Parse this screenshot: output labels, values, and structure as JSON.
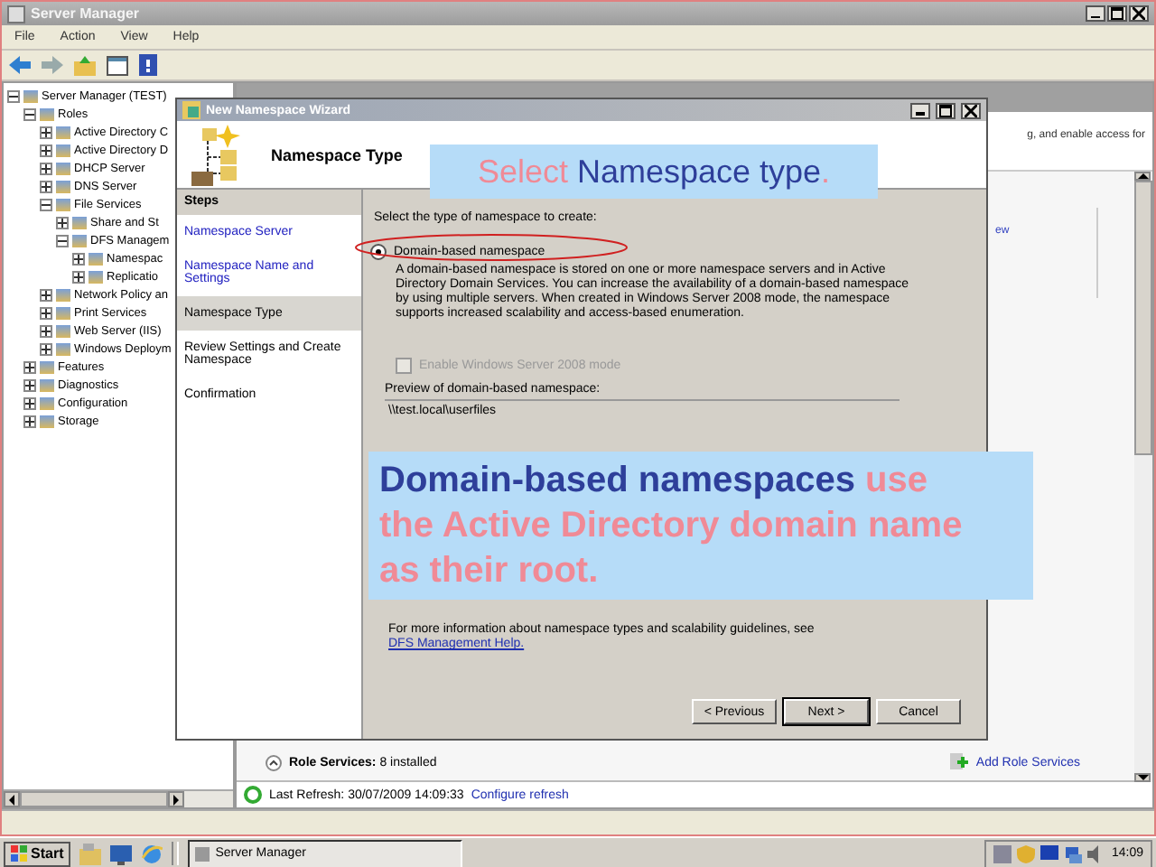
{
  "window": {
    "title": "Server Manager"
  },
  "menu": [
    "File",
    "Action",
    "View",
    "Help"
  ],
  "tree": [
    {
      "label": "Server Manager (TEST)",
      "expanded": true,
      "children": [
        {
          "label": "Roles",
          "expanded": true,
          "children": [
            {
              "label": "Active Directory C",
              "expanded": false
            },
            {
              "label": "Active Directory D",
              "expanded": false
            },
            {
              "label": "DHCP Server",
              "expanded": false
            },
            {
              "label": "DNS Server",
              "expanded": false
            },
            {
              "label": "File Services",
              "expanded": true,
              "children": [
                {
                  "label": "Share and St",
                  "expanded": false
                },
                {
                  "label": "DFS Managem",
                  "expanded": true,
                  "children": [
                    {
                      "label": "Namespac",
                      "expanded": false
                    },
                    {
                      "label": "Replicatio",
                      "expanded": false
                    }
                  ]
                }
              ]
            },
            {
              "label": "Network Policy an",
              "expanded": false
            },
            {
              "label": "Print Services",
              "expanded": false
            },
            {
              "label": "Web Server (IIS)",
              "expanded": false
            },
            {
              "label": "Windows Deploym",
              "expanded": false
            }
          ]
        },
        {
          "label": "Features",
          "expanded": false
        },
        {
          "label": "Diagnostics",
          "expanded": false
        },
        {
          "label": "Configuration",
          "expanded": false
        },
        {
          "label": "Storage",
          "expanded": false
        }
      ]
    }
  ],
  "right_pane": {
    "description": "g, and enable access for",
    "link_fragment": "ew",
    "role_services": {
      "label": "Role Services:",
      "value": "8 installed"
    },
    "add_link": "Add Role Services"
  },
  "refresh": {
    "text": "Last Refresh: 30/07/2009 14:09:33",
    "link": "Configure refresh"
  },
  "taskbar": {
    "start": "Start",
    "tasks": [
      {
        "label": "Server Manager",
        "selected": true
      }
    ],
    "clock": "14:09"
  },
  "wizard": {
    "title": "New Namespace Wizard",
    "heading": "Namespace Type",
    "steps_title": "Steps",
    "steps": [
      {
        "label": "Namespace Server",
        "selected": false,
        "done": true
      },
      {
        "label": "Namespace Name and Settings",
        "selected": false,
        "done": true
      },
      {
        "label": "Namespace Type",
        "selected": true,
        "done": false
      },
      {
        "label": "Review Settings and Create Namespace",
        "selected": false,
        "done": false
      },
      {
        "label": "Confirmation",
        "selected": false,
        "done": false
      }
    ],
    "prompt": "Select the type of namespace to create:",
    "option": {
      "label": "Domain-based namespace",
      "selected": true
    },
    "option_description": "A domain-based namespace is stored on one or more namespace servers and in Active Directory Domain Services. You can increase the availability of a domain-based namespace by using multiple servers. When created in Windows Server 2008 mode, the namespace supports increased scalability and access-based enumeration.",
    "mode_checkbox": {
      "label": "Enable Windows Server 2008 mode",
      "checked": false,
      "disabled": true
    },
    "preview_label": "Preview of domain-based namespace:",
    "preview_value": "\\\\test.local\\userfiles",
    "help_text": "For more information about namespace types and scalability guidelines, see",
    "help_link": "DFS Management Help.",
    "buttons": [
      {
        "label": "< Previous",
        "default": false
      },
      {
        "label": "Next >",
        "default": true
      },
      {
        "label": "Cancel",
        "default": false
      }
    ]
  },
  "callouts": [
    {
      "parts": [
        {
          "text": "Select ",
          "color": "#f08a96"
        },
        {
          "text": "Namespace type",
          "color": "#2e3f9a"
        },
        {
          "text": ".",
          "color": "#f08a96"
        }
      ]
    },
    {
      "parts": [
        {
          "text": "Domain-based namespaces ",
          "color": "#2e3f9a",
          "new_line": false
        },
        {
          "text": "use",
          "color": "#f08a96",
          "new_line": false
        },
        {
          "text": "the Active Directory domain name",
          "color": "#f08a96",
          "new_line": true
        },
        {
          "text": "as their root.",
          "color": "#f08a96",
          "new_line": true
        }
      ]
    }
  ]
}
